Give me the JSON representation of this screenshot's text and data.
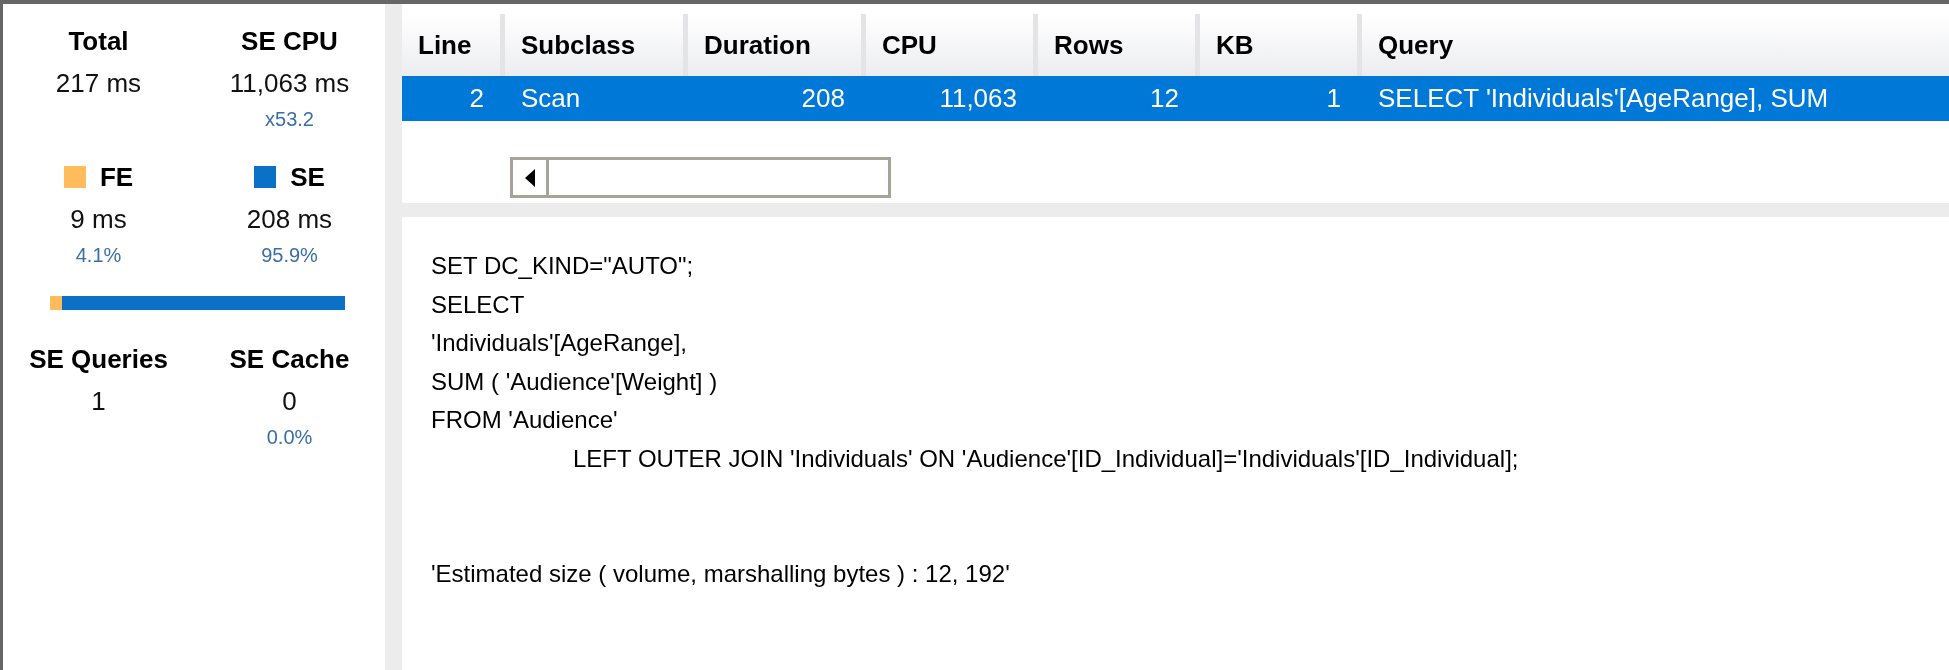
{
  "summary": {
    "metrics": [
      {
        "label": "Total",
        "value": "217 ms"
      },
      {
        "label": "SE CPU",
        "value": "11,063 ms",
        "note": "x53.2"
      }
    ],
    "split": [
      {
        "label": "FE",
        "value": "9 ms",
        "note": "4.1%",
        "color": "#ffbb5c"
      },
      {
        "label": "SE",
        "value": "208 ms",
        "note": "95.9%",
        "color": "#0a71c6"
      }
    ],
    "bar": {
      "level": 0.041
    },
    "counts": [
      {
        "label": "SE Queries",
        "value": "1"
      },
      {
        "label": "SE Cache",
        "value": "0",
        "note": "0.0%"
      }
    ]
  },
  "grid": {
    "columns": [
      {
        "label": "Line",
        "kind": "number"
      },
      {
        "label": "Subclass",
        "kind": "text"
      },
      {
        "label": "Duration",
        "kind": "number"
      },
      {
        "label": "CPU",
        "kind": "number"
      },
      {
        "label": "Rows",
        "kind": "number"
      },
      {
        "label": "KB",
        "kind": "number"
      },
      {
        "label": "Query",
        "kind": "text"
      }
    ],
    "rows": [
      {
        "selected": true,
        "cells": [
          "2",
          "Scan",
          "208",
          "11,063",
          "12",
          "1",
          "SELECT 'Individuals'[AgeRange], SUM"
        ]
      }
    ]
  },
  "query_text": {
    "lines": [
      {
        "text": "SET DC_KIND=\"AUTO\";",
        "indented": false
      },
      {
        "text": "SELECT",
        "indented": false
      },
      {
        "text": "'Individuals'[AgeRange],",
        "indented": false
      },
      {
        "text": "SUM ( 'Audience'[Weight] )",
        "indented": false
      },
      {
        "text": "FROM 'Audience'",
        "indented": false
      },
      {
        "text": "LEFT OUTER JOIN 'Individuals' ON 'Audience'[ID_Individual]='Individuals'[ID_Individual];",
        "indented": true
      }
    ],
    "footer": "'Estimated size ( volume, marshalling bytes ) : 12, 192'"
  }
}
